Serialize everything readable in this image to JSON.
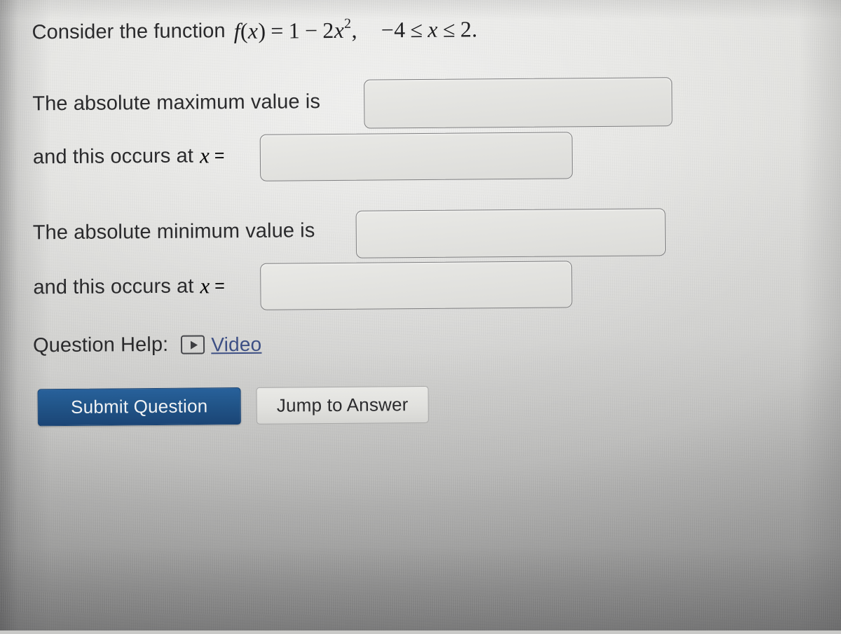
{
  "problem": {
    "lead_text": "Consider the function",
    "function_expr": {
      "fname": "f",
      "open_paren": "(",
      "var": "x",
      "close_paren": ")",
      "equals": "=",
      "one": "1",
      "minus": "−",
      "coefficient": "2",
      "base_var": "x",
      "exponent": "2",
      "comma": ","
    },
    "domain_expr": {
      "minus": "−",
      "lower": "4",
      "le1": "≤",
      "var": "x",
      "le2": "≤",
      "upper": "2",
      "period": "."
    }
  },
  "answers": {
    "max_value": {
      "label": "The absolute maximum value is",
      "input_value": "",
      "placeholder": ""
    },
    "max_x": {
      "label": "and this occurs at",
      "var": "x",
      "equals": "=",
      "input_value": "",
      "placeholder": ""
    },
    "min_value": {
      "label": "The absolute minimum value is",
      "input_value": "",
      "placeholder": ""
    },
    "min_x": {
      "label": "and this occurs at",
      "var": "x",
      "equals": "=",
      "input_value": "",
      "placeholder": ""
    }
  },
  "help": {
    "label": "Question Help:",
    "video_icon": "video-play-icon",
    "video_link": "Video"
  },
  "actions": {
    "submit_label": "Submit Question",
    "jump_label": "Jump to Answer"
  },
  "colors": {
    "submit_button_bg": "#215589",
    "submit_button_text": "#f0f2f4",
    "jump_button_bg": "#e1e1de",
    "link_blue": "#3d4f84",
    "text": "#2a2a2c",
    "input_border": "#7f7f80",
    "page_bg": "#dedede"
  }
}
